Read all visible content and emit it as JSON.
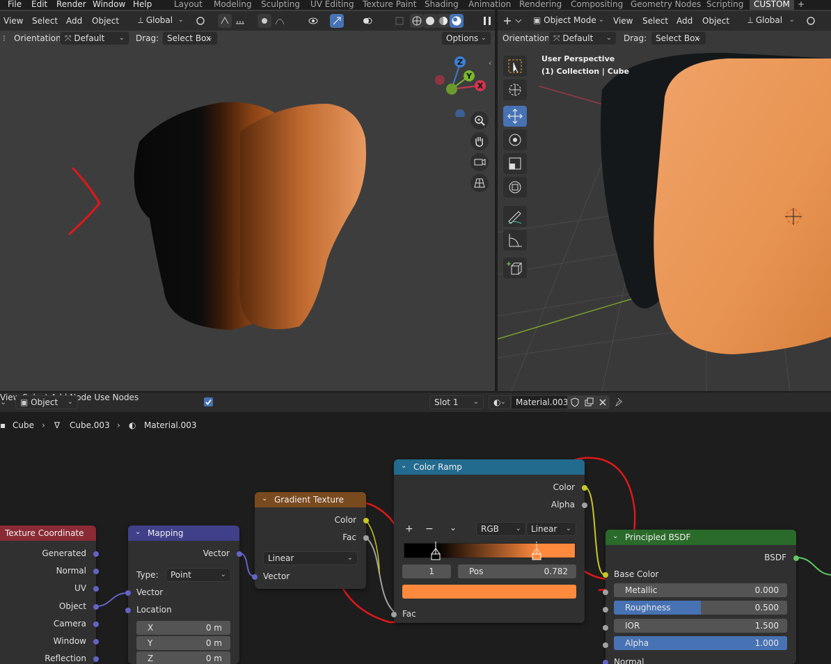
{
  "topbar": {
    "menus": [
      "File",
      "Edit",
      "Render",
      "Window",
      "Help"
    ],
    "workspaces": [
      "Layout",
      "Modeling",
      "Sculpting",
      "UV Editing",
      "Texture Paint",
      "Shading",
      "Animation",
      "Rendering",
      "Compositing",
      "Geometry Nodes",
      "Scripting",
      "CUSTOM"
    ],
    "active_workspace": "CUSTOM",
    "add_tab": "+"
  },
  "left_viewport": {
    "menus": [
      "View",
      "Select",
      "Add",
      "Object"
    ],
    "transform_orientation": "Global",
    "orientation_label": "Orientation:",
    "orientation_value": "Default",
    "drag_label": "Drag:",
    "drag_value": "Select Box",
    "options_label": "Options",
    "gizmo": {
      "x": "X",
      "y": "Y",
      "z": "Z"
    }
  },
  "right_viewport": {
    "mode": "Object Mode",
    "menus": [
      "View",
      "Select",
      "Add",
      "Object"
    ],
    "transform_orientation": "Global",
    "orientation_label": "Orientation:",
    "orientation_value": "Default",
    "drag_label": "Drag:",
    "drag_value": "Select Box",
    "overlay_line1": "User Perspective",
    "overlay_line2": "(1) Collection | Cube"
  },
  "node_editor": {
    "object_type": "Object",
    "menus": [
      "View",
      "Select",
      "Add",
      "Node"
    ],
    "use_nodes_label": "Use Nodes",
    "use_nodes_checked": true,
    "slot": "Slot 1",
    "material_name": "Material.003",
    "breadcrumb": [
      "Cube",
      "Cube.003",
      "Material.003"
    ]
  },
  "nodes": {
    "texture_coordinate": {
      "title": "Texture Coordinate",
      "header_color": "#8a2a34",
      "outputs": [
        "Generated",
        "Normal",
        "UV",
        "Object",
        "Camera",
        "Window",
        "Reflection"
      ]
    },
    "mapping": {
      "title": "Mapping",
      "header_color": "#3f3f8a",
      "output": "Vector",
      "type_label": "Type:",
      "type_value": "Point",
      "inputs": [
        "Vector",
        "Location"
      ],
      "fields": [
        {
          "label": "X",
          "value": "0 m"
        },
        {
          "label": "Y",
          "value": "0 m"
        },
        {
          "label": "Z",
          "value": "0 m"
        }
      ]
    },
    "gradient_texture": {
      "title": "Gradient Texture",
      "header_color": "#7a4a1f",
      "outputs": [
        "Color",
        "Fac"
      ],
      "interpolation": "Linear",
      "input": "Vector"
    },
    "color_ramp": {
      "title": "Color Ramp",
      "header_color": "#236a8f",
      "outputs": [
        "Color",
        "Alpha"
      ],
      "add": "+",
      "remove": "−",
      "color_mode": "RGB",
      "interpolation": "Linear",
      "stop_index": "1",
      "pos_label": "Pos",
      "pos_value": "0.782",
      "stop_color": "#ff8a3d",
      "input": "Fac"
    },
    "principled_bsdf": {
      "title": "Principled BSDF",
      "header_color": "#2a6a2a",
      "output": "BSDF",
      "base_color_label": "Base Color",
      "fields": [
        {
          "label": "Metallic",
          "value": "0.000",
          "fill": 0.0
        },
        {
          "label": "Roughness",
          "value": "0.500",
          "fill": 0.5
        },
        {
          "label": "IOR",
          "value": "1.500",
          "fill": 0.0
        },
        {
          "label": "Alpha",
          "value": "1.000",
          "fill": 1.0
        }
      ],
      "normal_label": "Normal"
    }
  }
}
